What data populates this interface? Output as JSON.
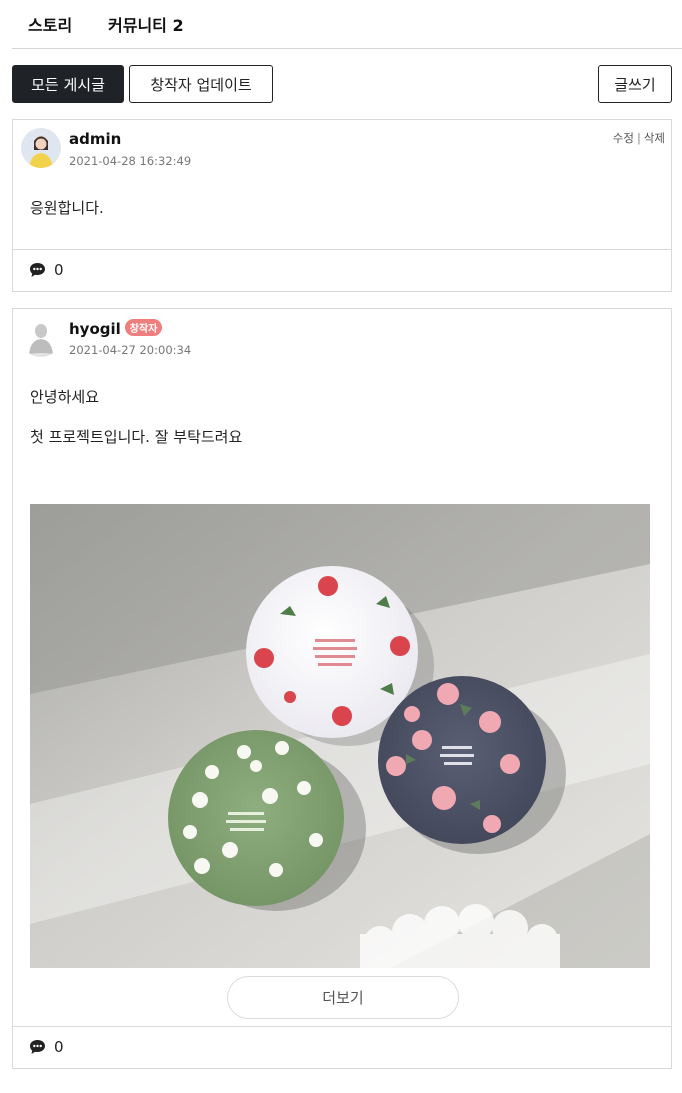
{
  "tabs": [
    {
      "label": "스토리"
    },
    {
      "label": "커뮤니티 2"
    }
  ],
  "filters": {
    "all": "모든 게시글",
    "creator_updates": "창작자 업데이트",
    "write": "글쓰기"
  },
  "posts": [
    {
      "author": "admin",
      "date": "2021-04-28 16:32:49",
      "actions": {
        "edit": "수정",
        "separator": "|",
        "delete": "삭제"
      },
      "lines": [
        "응원합니다."
      ],
      "comments": "0"
    },
    {
      "author": "hyogil",
      "badge": "창작자",
      "date": "2021-04-27 20:00:34",
      "lines": [
        "안녕하세요",
        "첫 프로젝트입니다. 잘 부탁드려요"
      ],
      "more": "더보기",
      "comments": "0"
    }
  ],
  "icons": {
    "comment": "speech-bubble-icon"
  },
  "colors": {
    "primary_dark": "#1f2227",
    "badge": "#ef7f7f",
    "border": "#d9d9d9"
  }
}
